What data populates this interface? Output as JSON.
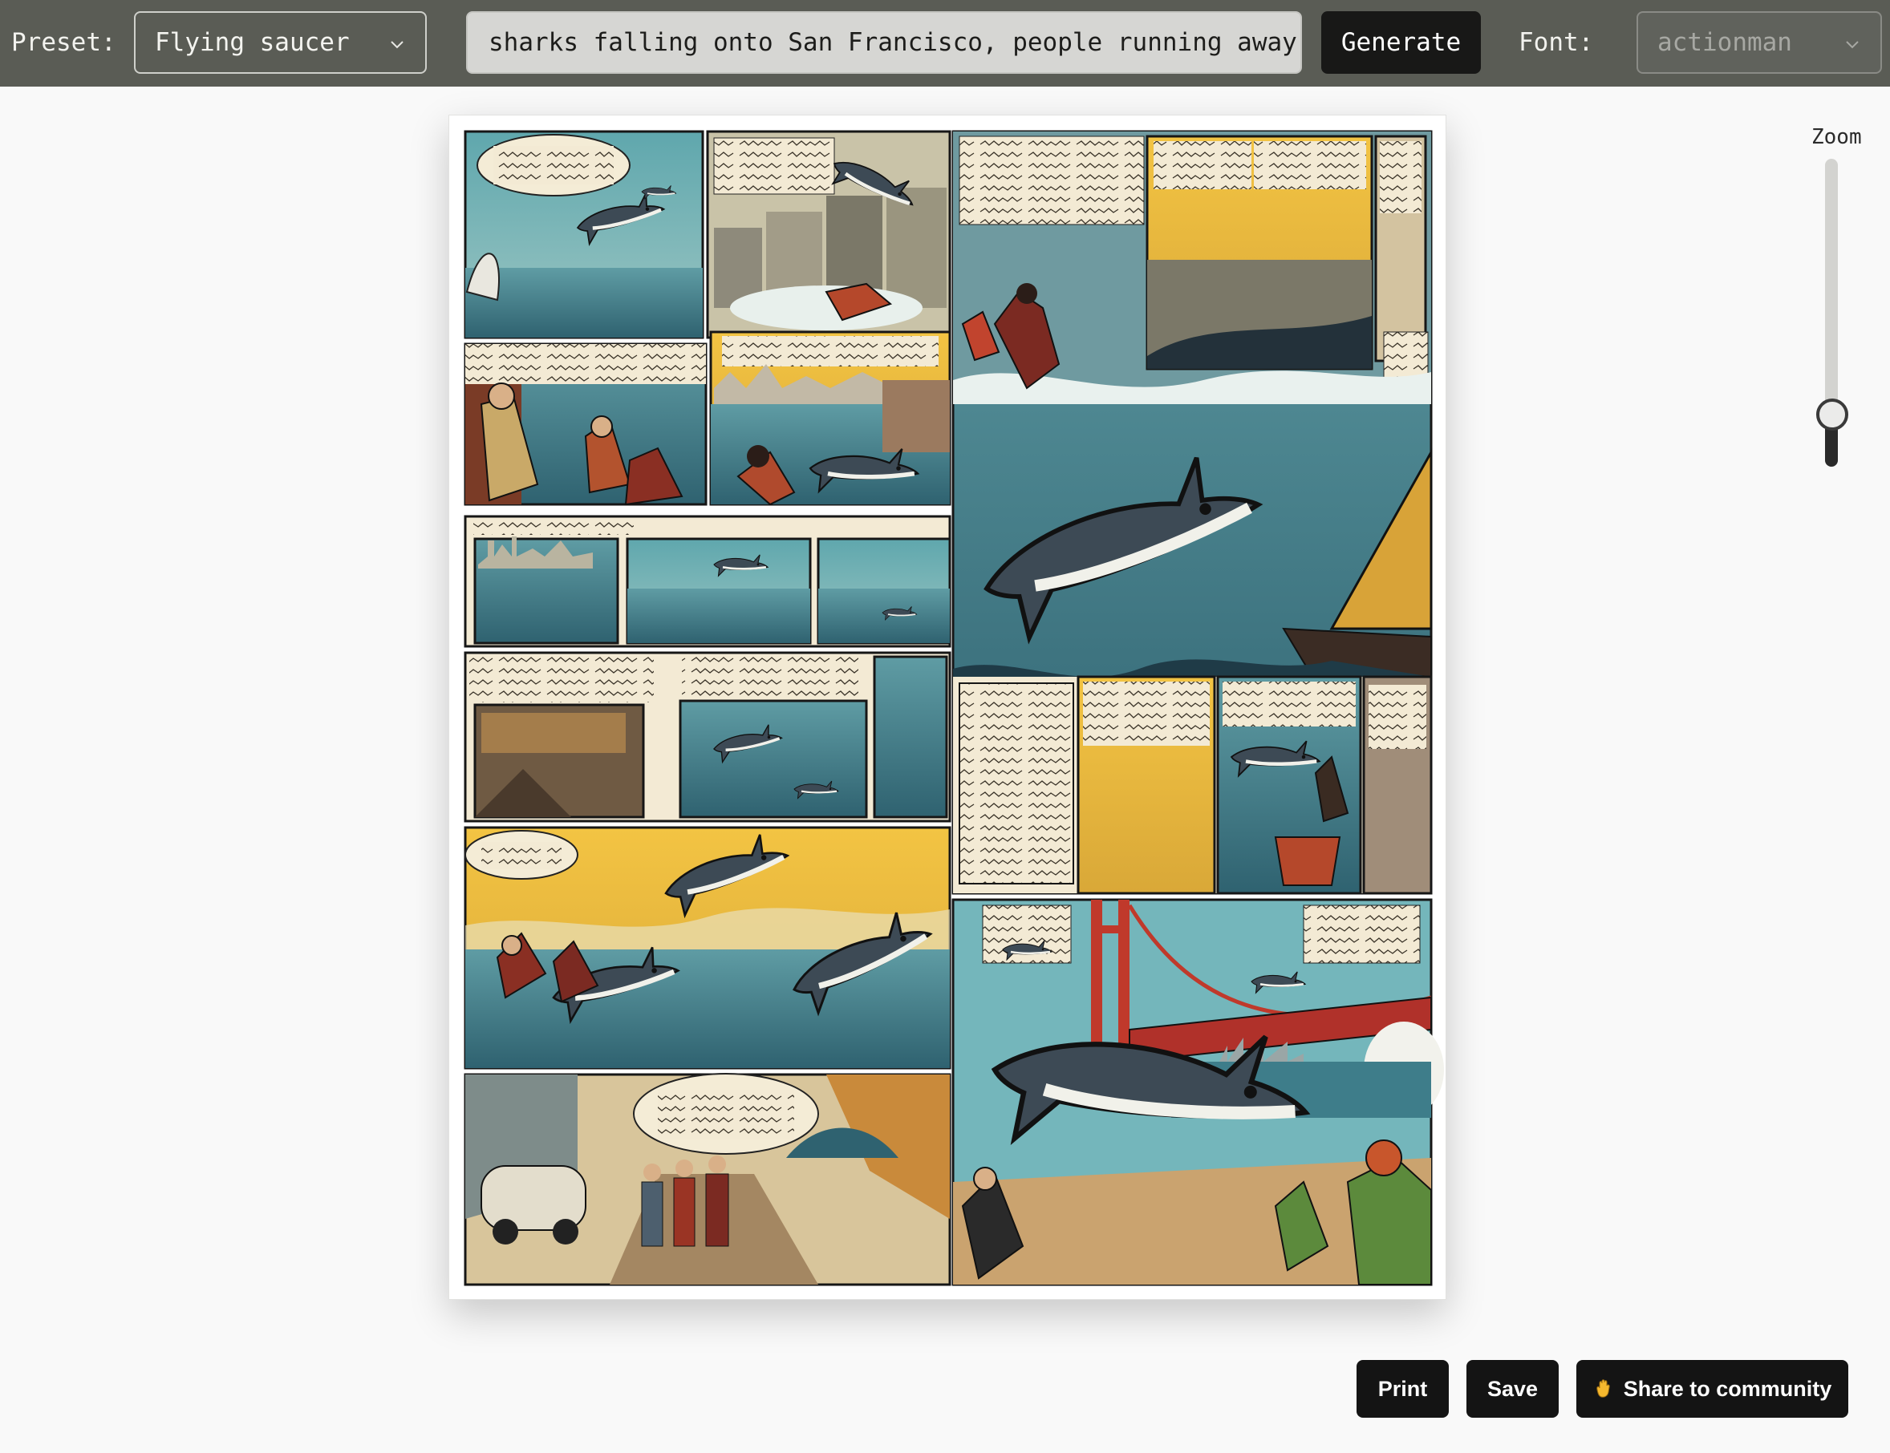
{
  "toolbar": {
    "preset_label": "Preset:",
    "preset_value": "Flying saucer",
    "prompt_value": "sharks falling onto San Francisco, people running away",
    "generate_label": "Generate",
    "font_label": "Font:",
    "font_value": "actionman"
  },
  "zoom": {
    "label": "Zoom",
    "level": 0.21
  },
  "actions": {
    "print_label": "Print",
    "save_label": "Save",
    "share_label": "Share to community"
  },
  "icons": {
    "preset_chevron": "chevron-down-icon",
    "font_chevron": "chevron-down-icon",
    "share": "waving-hand-icon"
  },
  "colors": {
    "topbar_bg": "#5a5c55",
    "button_bg": "#141414",
    "page_bg": "#f9f9f9",
    "comic_teal": "#4f8f98",
    "comic_yellow": "#f0c43a",
    "bridge_red": "#c0392b"
  }
}
